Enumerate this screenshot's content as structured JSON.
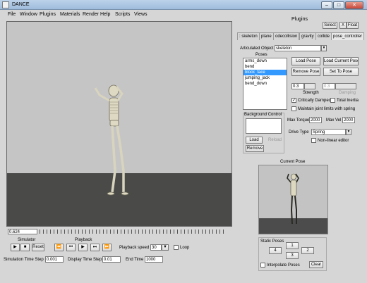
{
  "window": {
    "title": "DANCE",
    "minimize": "–",
    "maximize": "□",
    "close": "✕"
  },
  "menu": [
    "File",
    "Window",
    "Plugins",
    "Materials",
    "Render",
    "Help",
    "Scripts",
    "Views"
  ],
  "plugins": {
    "header": "Plugins",
    "select_label": "Select",
    "x_label": "X",
    "float_label": "Float",
    "tabs": [
      ": skeleton",
      "plane",
      "odecollision",
      "gravity",
      "collide",
      "pose_controller"
    ],
    "articulated_object_label": "Articulated Object",
    "articulated_object_value": "skeleton",
    "poses_header": "Poses",
    "poses": [
      "arms_down",
      "bend",
      "block_face",
      "jumping_jack",
      "bend_down"
    ],
    "selected_pose": "block_face",
    "load_pose": "Load Pose",
    "load_current_pose": "Load Current Pose",
    "remove_pose": "Remove Pose",
    "set_to_pose": "Set To Pose",
    "strength_value": "0.3",
    "damping_value": "0.3",
    "strength_label": "Strength",
    "damping_label": "Damping",
    "critically_damped": "Critically Damped",
    "critically_damped_checked": true,
    "total_inertia": "Total Inertia",
    "total_inertia_checked": false,
    "maintain_joint_limits": "Maintain joint limits with spring",
    "maintain_joint_limits_checked": false,
    "background_control_label": "Background Control",
    "load": "Load",
    "reload": "Reload",
    "remove": "Remove",
    "max_torque_label": "Max Torque",
    "max_torque_value": "2000",
    "max_vel_label": "Max Vel",
    "max_vel_value": "2000",
    "drive_type_label": "Drive Type",
    "drive_type_value": "Spring",
    "non_linear_editor": "Non-linear editor",
    "current_pose_label": "Current Pose",
    "static_poses_label": "Static Poses",
    "static_pose_buttons": [
      "1",
      "2",
      "3",
      "4"
    ],
    "interpolate_poses": "Interpolate Poses",
    "clear": "Clear"
  },
  "timeline": {
    "current_time": "0.624"
  },
  "simulator": {
    "label": "Simulator",
    "reset": "Reset",
    "sim_time_step_label": "Simulation Time Step",
    "sim_time_step_value": "0.001"
  },
  "playback": {
    "label": "Playback",
    "speed_label": "Playback speed",
    "speed_value": "30",
    "loop_label": "Loop",
    "loop_checked": false,
    "display_time_step_label": "Display Time Step",
    "display_time_step_value": "0.01",
    "end_time_label": "End Time",
    "end_time_value": "1000"
  },
  "icons": {
    "play": "▶",
    "stop": "■",
    "rewind_fast": "⏪",
    "step_back": "⏮",
    "fast_forward": "⏩",
    "step_forward": "⏭",
    "dropdown": "▼",
    "check": "✓"
  }
}
